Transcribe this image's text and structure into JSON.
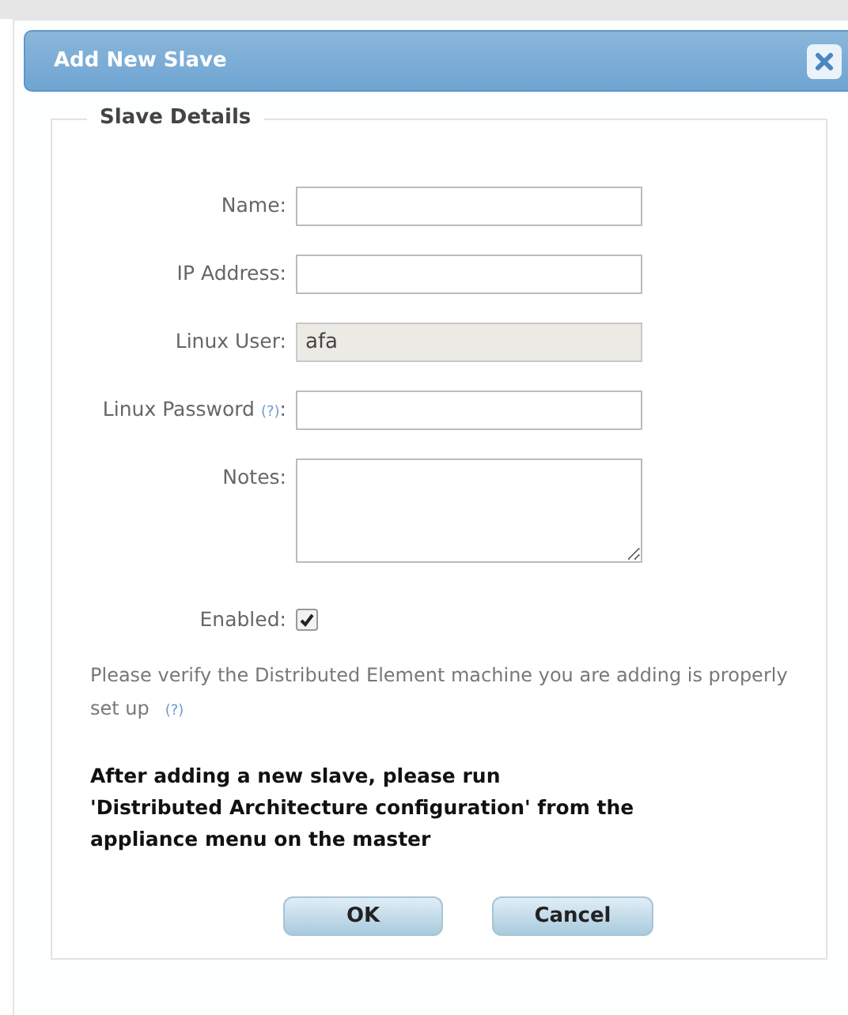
{
  "window": {
    "title": "Add New Slave"
  },
  "fieldset": {
    "legend": "Slave Details"
  },
  "fields": [
    {
      "kind": "text",
      "label": "Name:",
      "disabled": false
    },
    {
      "kind": "text",
      "label": "IP Address:",
      "disabled": false
    },
    {
      "kind": "text",
      "label": "Linux User:",
      "value": "afa",
      "disabled": true
    },
    {
      "kind": "text",
      "label": "Linux Password",
      "help": "(?)",
      "colon": ":",
      "disabled": false
    },
    {
      "kind": "textarea",
      "label": "Notes:",
      "disabled": false
    },
    {
      "kind": "checkbox",
      "label": "Enabled:",
      "checked": true
    }
  ],
  "note": {
    "text": "Please verify the Distributed Element machine you are adding is properly set up",
    "help": "(?)"
  },
  "warning": [
    "After adding a new slave, please run",
    "'Distributed Architecture configuration' from the",
    "appliance menu on the master"
  ],
  "buttons": [
    "OK",
    "Cancel"
  ]
}
